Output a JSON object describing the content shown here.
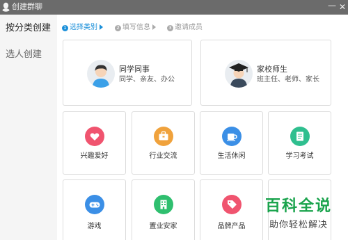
{
  "window": {
    "title": "创建群聊",
    "minimize_glyph": "—",
    "close_glyph": "✕"
  },
  "sidebar": {
    "items": [
      {
        "label": "按分类创建",
        "active": true
      },
      {
        "label": "选人创建",
        "active": false
      }
    ]
  },
  "steps": [
    {
      "num": "1",
      "label": "选择类别",
      "active": true
    },
    {
      "num": "2",
      "label": "填写信息",
      "active": false
    },
    {
      "num": "3",
      "label": "邀请成员",
      "active": false
    }
  ],
  "categories_big": [
    {
      "title": "同学同事",
      "subtitle": "同学、亲友、办公",
      "icon": "student-avatar-icon"
    },
    {
      "title": "家校师生",
      "subtitle": "班主任、老师、家长",
      "icon": "graduate-avatar-icon"
    }
  ],
  "categories_small": [
    {
      "label": "兴趣爱好",
      "icon": "heart-icon",
      "color": "#f0546f"
    },
    {
      "label": "行业交流",
      "icon": "briefcase-icon",
      "color": "#f0a23c"
    },
    {
      "label": "生活休闲",
      "icon": "coffee-cup-icon",
      "color": "#3b8fe6"
    },
    {
      "label": "学习考试",
      "icon": "notebook-icon",
      "color": "#2fbf8f"
    },
    {
      "label": "游戏",
      "icon": "gamepad-icon",
      "color": "#3b8fe6"
    },
    {
      "label": "置业安家",
      "icon": "building-icon",
      "color": "#2fbf6f"
    },
    {
      "label": "品牌产品",
      "icon": "tag-icon",
      "color": "#f0546f"
    },
    {
      "label": "",
      "icon": "",
      "color": "#ffffff"
    }
  ],
  "watermark": {
    "title": "百科全说",
    "subtitle": "助你轻松解决",
    "color": "#19a34c"
  }
}
